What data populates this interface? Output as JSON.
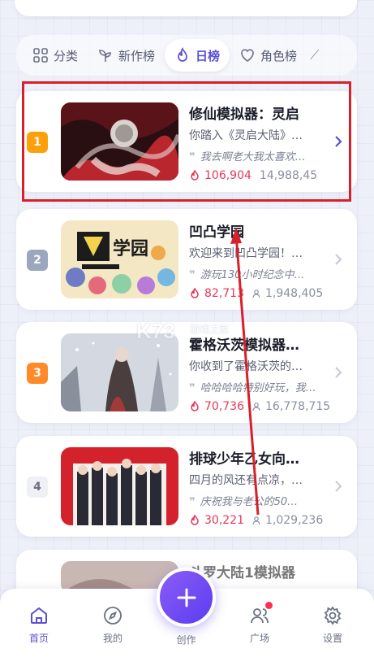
{
  "tabs": [
    {
      "label": "分类",
      "icon": "grid-icon",
      "active": false
    },
    {
      "label": "新作榜",
      "icon": "sprout-icon",
      "active": false
    },
    {
      "label": "日榜",
      "icon": "flame-icon",
      "active": true
    },
    {
      "label": "角色榜",
      "icon": "heart-icon",
      "active": false
    }
  ],
  "ranking": [
    {
      "rank": "1",
      "title": "修仙模拟器：灵启",
      "desc": "你踏入《灵启大陆》…",
      "quote": "我去啊老大我太喜欢…",
      "heat": "106,904",
      "users": "14,988,45",
      "rank_color": "#ff9f0a"
    },
    {
      "rank": "2",
      "title": "凹凸学园",
      "desc": "欢迎来到凹凸学园！…",
      "quote": "游玩130小时纪念中…",
      "heat": "82,713",
      "users": "1,948,405",
      "rank_color": "#9aa7bd"
    },
    {
      "rank": "3",
      "title": "霍格沃茨模拟器…",
      "desc": "你收到了霍格沃茨的…",
      "quote": "哈哈哈哈特别好玩，我…",
      "heat": "70,736",
      "users": "16,778,715",
      "rank_color": "#ff8a2a"
    },
    {
      "rank": "4",
      "title": "排球少年乙女向…",
      "desc": "四月的风还有点凉，…",
      "quote": "庆祝我与老公的50…",
      "heat": "30,221",
      "users": "1,029,236",
      "rank_color": "#eef0f6"
    },
    {
      "rank": "",
      "title": "斗罗大陆1模拟器",
      "desc": "",
      "quote": "",
      "heat": "",
      "users": "",
      "rank_color": "#ffffff"
    }
  ],
  "bottom_nav": {
    "home": "首页",
    "mine": "我的",
    "create": "创作",
    "plaza": "广场",
    "settings": "设置"
  },
  "cover_text": {
    "card2": "学园"
  },
  "watermark": {
    "logo": "K73",
    "text": "游戏之家"
  },
  "colors": {
    "accent": "#5a4fd6",
    "heat": "#e3385a",
    "highlight_box": "#d8202a",
    "arrow": "#d8202a"
  }
}
